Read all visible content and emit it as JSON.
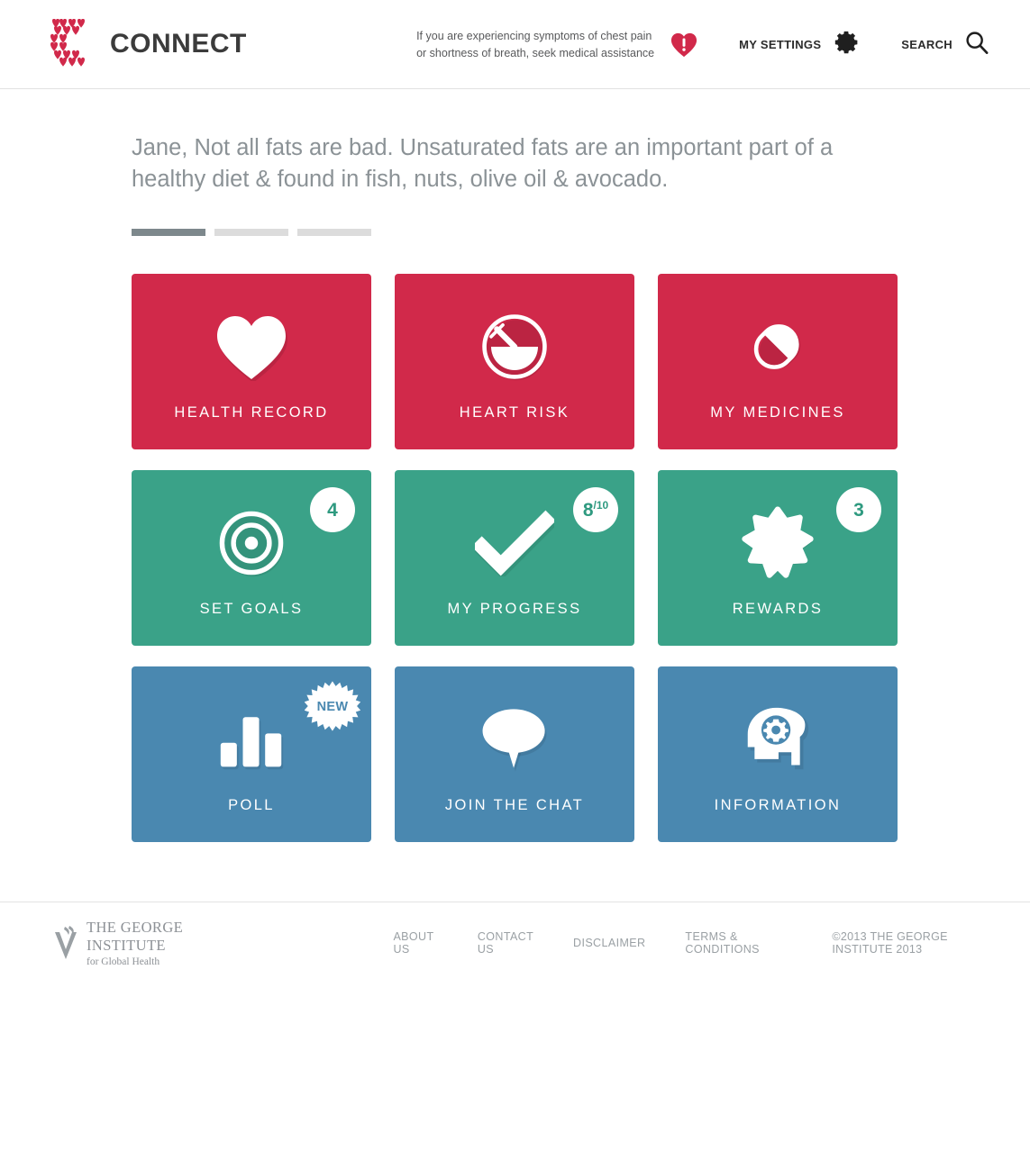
{
  "header": {
    "brand_name": "CONNECT",
    "logo_icon": "connect-hearts-c-logo",
    "emergency_line1": "If you are experiencing symptoms of chest pain",
    "emergency_line2": "or shortness of breath, seek medical assistance",
    "emergency_icon": "heart-exclamation-icon",
    "settings_label": "MY SETTINGS",
    "settings_icon": "gear-icon",
    "search_label": "SEARCH",
    "search_icon": "search-icon"
  },
  "main": {
    "tagline": "Jane, Not all fats are bad. Unsaturated fats are an important part of a healthy diet & found in fish, nuts, olive oil & avocado.",
    "carousel": {
      "total": 3,
      "active_index": 0
    }
  },
  "tiles": [
    {
      "label": "HEALTH RECORD",
      "icon": "heart-icon",
      "color": "#d1294a",
      "theme": "red"
    },
    {
      "label": "HEART RISK",
      "icon": "gauge-icon",
      "color": "#d1294a",
      "theme": "red"
    },
    {
      "label": "MY MEDICINES",
      "icon": "pill-icon",
      "color": "#d1294a",
      "theme": "red"
    },
    {
      "label": "SET GOALS",
      "icon": "target-icon",
      "color": "#3aa288",
      "theme": "green",
      "badge": "4"
    },
    {
      "label": "MY PROGRESS",
      "icon": "checkmark-icon",
      "color": "#3aa288",
      "theme": "green",
      "badge": "8",
      "badge_sub": "/10"
    },
    {
      "label": "REWARDS",
      "icon": "star-icon",
      "color": "#3aa288",
      "theme": "green",
      "badge": "3"
    },
    {
      "label": "POLL",
      "icon": "bar-chart-icon",
      "color": "#4a88b0",
      "theme": "blue",
      "starburst": "NEW"
    },
    {
      "label": "JOIN THE CHAT",
      "icon": "speech-bubble-icon",
      "color": "#4a88b0",
      "theme": "blue"
    },
    {
      "label": "INFORMATION",
      "icon": "head-gear-icon",
      "color": "#4a88b0",
      "theme": "blue"
    }
  ],
  "footer": {
    "institute_line1": "THE GEORGE INSTITUTE",
    "institute_line2": "for Global Health",
    "institute_icon": "george-institute-mark",
    "links": [
      "ABOUT US",
      "CONTACT US",
      "DISCLAIMER",
      "TERMS & CONDITIONS"
    ],
    "copyright": "©2013 THE GEORGE INSTITUTE 2013"
  },
  "colors": {
    "red": "#d1294a",
    "green": "#3aa288",
    "blue": "#4a88b0",
    "text_gray": "#8b9296"
  }
}
